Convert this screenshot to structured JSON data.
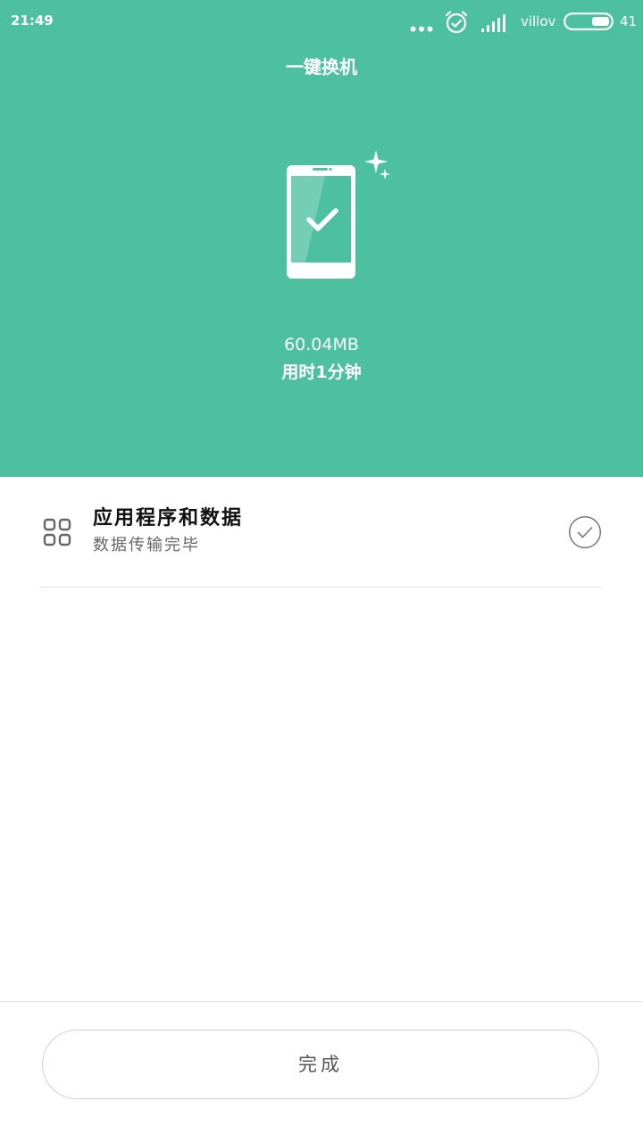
{
  "status_bar": {
    "time": "21:49",
    "carrier": "villov",
    "battery_level": "41",
    "icons": [
      "more-dots-icon",
      "alarm-clock-icon",
      "signal-icon",
      "battery-icon"
    ]
  },
  "header": {
    "title": "一键换机",
    "illustration": "phone-check-icon",
    "transfer_size": "60.04MB",
    "transfer_time": "用时1分钟",
    "background_color": "#4dc19f"
  },
  "items": [
    {
      "icon": "apps-grid-icon",
      "title": "应用程序和数据",
      "subtitle": "数据传输完毕",
      "status_icon": "check-circle-icon"
    }
  ],
  "footer": {
    "done_label": "完成"
  }
}
